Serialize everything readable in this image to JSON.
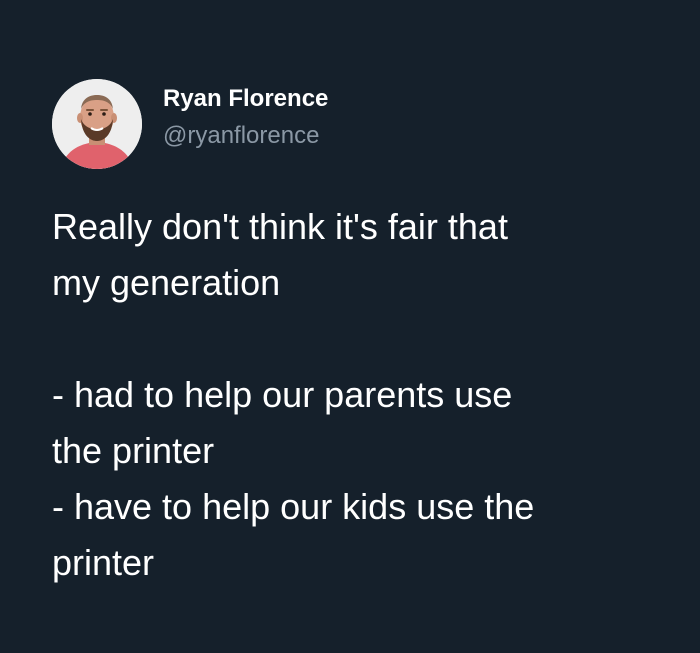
{
  "author": {
    "display_name": "Ryan Florence",
    "handle": "@ryanflorence",
    "avatar_icon": "profile-photo-avatar"
  },
  "tweet": {
    "lines": [
      "Really don't think it's fair that",
      "my generation",
      "",
      "- had to help our parents use",
      "the printer",
      "- have to help our kids use the",
      "printer"
    ]
  },
  "colors": {
    "background": "#15202b",
    "text": "#ffffff",
    "handle": "#8b98a5"
  }
}
